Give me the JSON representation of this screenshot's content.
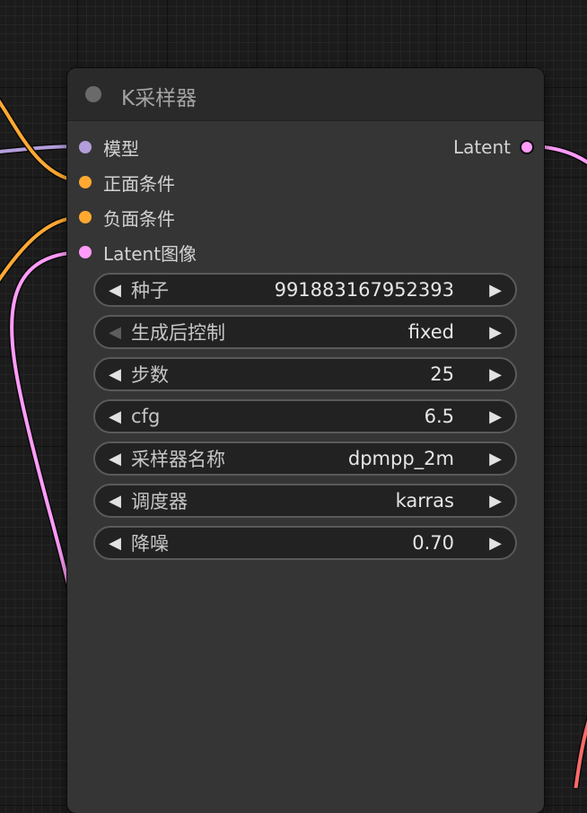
{
  "node": {
    "title": "K采样器",
    "colors": {
      "body": "#353535",
      "header": "#2a2a2a",
      "widget": "#222222"
    },
    "inputs": [
      {
        "label": "模型",
        "color": "#b39ddb"
      },
      {
        "label": "正面条件",
        "color": "#ffa931"
      },
      {
        "label": "负面条件",
        "color": "#ffa931"
      },
      {
        "label": "Latent图像",
        "color": "#ff9cf9"
      }
    ],
    "outputs": [
      {
        "label": "Latent",
        "color": "#ff9cf9"
      }
    ],
    "widgets": [
      {
        "label": "种子",
        "value": "991883167952393",
        "left_arrow": "◀",
        "right_arrow": "▶"
      },
      {
        "label": "生成后控制",
        "value": "fixed",
        "left_arrow": "◀",
        "right_arrow": "▶"
      },
      {
        "label": "步数",
        "value": "25",
        "left_arrow": "◀",
        "right_arrow": "▶"
      },
      {
        "label": "cfg",
        "value": "6.5",
        "left_arrow": "◀",
        "right_arrow": "▶"
      },
      {
        "label": "采样器名称",
        "value": "dpmpp_2m",
        "left_arrow": "◀",
        "right_arrow": "▶"
      },
      {
        "label": "调度器",
        "value": "karras",
        "left_arrow": "◀",
        "right_arrow": "▶"
      },
      {
        "label": "降噪",
        "value": "0.70",
        "left_arrow": "◀",
        "right_arrow": "▶"
      }
    ]
  },
  "link_colors": {
    "model": "#b39ddb",
    "conditioning": "#ffa931",
    "latent": "#ff9cf9",
    "image": "#ff6b6b"
  }
}
